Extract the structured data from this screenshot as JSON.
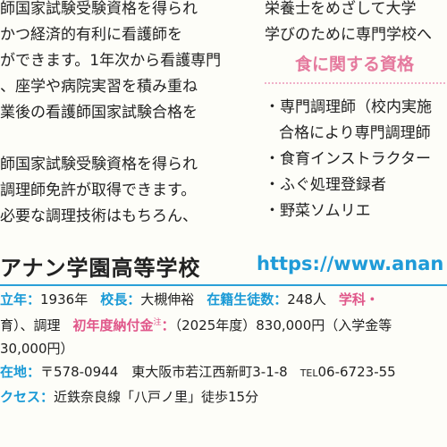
{
  "left_col": [
    "師国家試験受験資格を得られ",
    "かつ経済的有利に看護師を",
    "ができます。1年次から看護専門",
    "、座学や病院実習を積み重ね",
    "業後の看護師国家試験合格を",
    "",
    "師国家試験受験資格を得られ",
    "調理師免許が取得できます。",
    "必要な調理技術はもちろん、"
  ],
  "right_col": [
    "栄養士をめざして大学",
    "学びのために専門学校へ"
  ],
  "food_heading": "食に関する資格",
  "qualifications": [
    "・専門調理師（校内実施",
    "合格により専門調理師",
    "・食育インストラクター",
    "・ふぐ処理登録者",
    "・野菜ソムリエ"
  ],
  "school_name": "アナン学園高等学校",
  "school_url": "https://www.anan",
  "info": {
    "founded_label": "立年：",
    "founded_value": "1936年",
    "principal_label": "校長：",
    "principal_value": "大槻伸裕",
    "students_label": "在籍生徒数：",
    "students_value": "248人",
    "dept_label": "学科・",
    "dept_value": "育）、調理",
    "fee_label": "初年度納付金",
    "fee_note": "注",
    "fee_colon": "：",
    "fee_value": "（2025年度）830,000円（入学金等",
    "fee_value_2": "30,000円）",
    "address_label": "在地：",
    "address_value": "〒578-0944　東大阪市若江西新町3-1-8",
    "tel_prefix": "TEL",
    "tel_value": "06-6723-55",
    "access_label": "クセス：",
    "access_value": "近鉄奈良線「八戸ノ里」徒歩15分"
  }
}
